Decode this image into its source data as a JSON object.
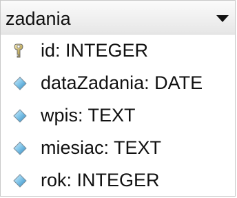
{
  "table": {
    "name": "zadania",
    "fields": [
      {
        "label": "id: INTEGER",
        "icon": "primary-key-icon"
      },
      {
        "label": "dataZadania: DATE",
        "icon": "field-diamond-icon"
      },
      {
        "label": "wpis: TEXT",
        "icon": "field-diamond-icon"
      },
      {
        "label": "miesiac: TEXT",
        "icon": "field-diamond-icon"
      },
      {
        "label": "rok: INTEGER",
        "icon": "field-diamond-icon"
      }
    ]
  },
  "colors": {
    "field_icon": "#4aa6d8",
    "key_icon": "#b9a55a",
    "border": "#c9c9c9"
  }
}
